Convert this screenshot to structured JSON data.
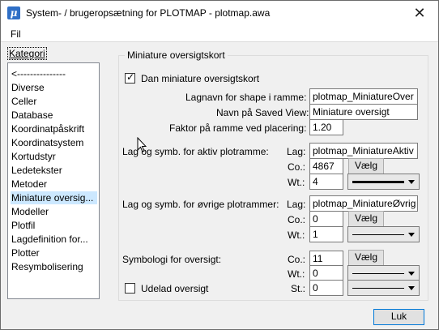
{
  "titlebar": {
    "app_icon_glyph": "μ",
    "title": "System- / brugeropsætning for PLOTMAP - plotmap.awa",
    "close_glyph": "✕"
  },
  "menubar": {
    "file_label": "Fil"
  },
  "category": {
    "header": "Kategori",
    "items": [
      "<---------------",
      "Diverse",
      "Celler",
      "Database",
      "Koordinatpåskrift",
      "Koordinatsystem",
      "Kortudstyr",
      "Ledetekster",
      "Metoder",
      "Miniature oversig...",
      "Modeller",
      "Plotfil",
      "Lagdefinition for...",
      "Plotter",
      "Resymbolisering"
    ],
    "selected_index": 9
  },
  "panel": {
    "title": "Miniature oversigtskort",
    "enable_checkbox": {
      "label": "Dan miniature oversigtskort",
      "checked": true
    },
    "shape_layer": {
      "label": "Lagnavn for shape i ramme:",
      "value": "plotmap_MiniatureOver"
    },
    "saved_view": {
      "label": "Navn på Saved View:",
      "value": "Miniature oversigt"
    },
    "placement_factor": {
      "label": "Faktor på ramme ved placering:",
      "value": "1.20"
    },
    "active_frame": {
      "label": "Lag og symb. for aktiv plotramme:",
      "level_label": "Lag:",
      "level_value": "plotmap_MiniatureAktiv",
      "color_label": "Co.:",
      "color_value": "4867",
      "weight_label": "Wt.:",
      "weight_value": "4",
      "select_label": "Vælg"
    },
    "other_frames": {
      "label": "Lag og symb. for øvrige plotrammer:",
      "level_label": "Lag:",
      "level_value": "plotmap_MiniatureØvrig",
      "color_label": "Co.:",
      "color_value": "0",
      "weight_label": "Wt.:",
      "weight_value": "1",
      "select_label": "Vælg"
    },
    "overview_symbology": {
      "label": "Symbologi for oversigt:",
      "color_label": "Co.:",
      "color_value": "11",
      "weight_label": "Wt.:",
      "weight_value": "0",
      "style_label": "St.:",
      "style_value": "0",
      "select_label": "Vælg"
    },
    "exclude_checkbox": {
      "label": "Udelad oversigt",
      "checked": false
    }
  },
  "footer": {
    "ok_label": "Luk"
  }
}
